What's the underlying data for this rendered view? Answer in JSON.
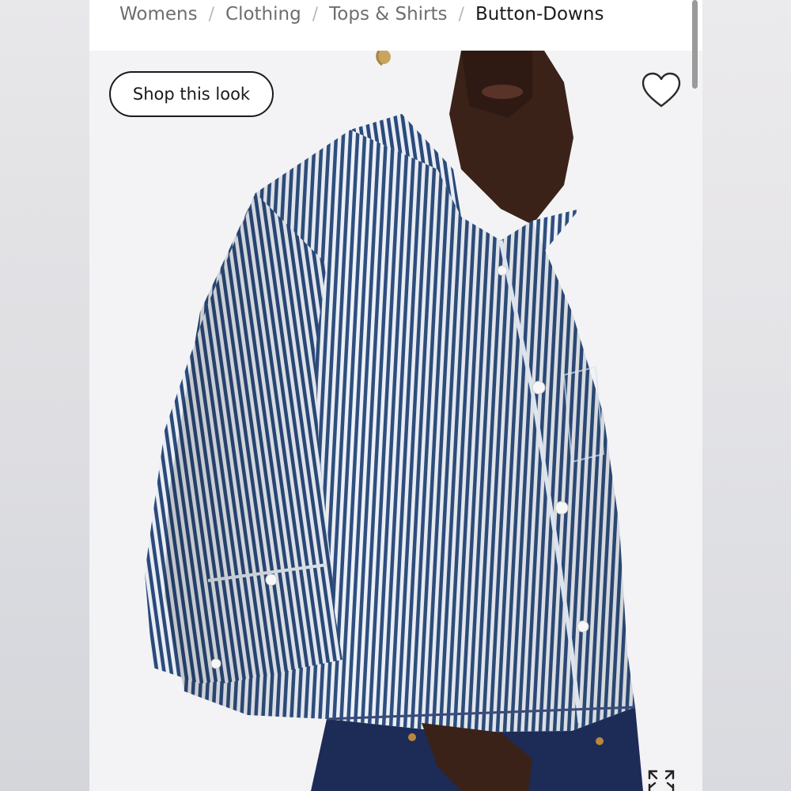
{
  "breadcrumb": {
    "items": [
      {
        "label": "Womens"
      },
      {
        "label": "Clothing"
      },
      {
        "label": "Tops & Shirts"
      },
      {
        "label": "Button-Downs"
      }
    ],
    "separator": "/"
  },
  "product_image": {
    "shop_look_label": "Shop this look"
  },
  "icons": {
    "favorite": "heart-icon",
    "expand": "expand-icon"
  },
  "colors": {
    "stripe_navy": "#2f4f80",
    "stripe_white": "#eef2f7",
    "denim": "#1d2b57",
    "skin": "#3b2218",
    "page_bg": "#f4f4f6"
  }
}
